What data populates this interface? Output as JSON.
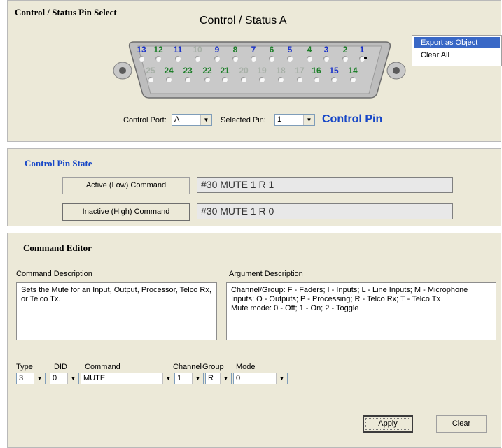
{
  "pin_select": {
    "header": "Control / Status Pin Select",
    "connector_title": "Control / Status A",
    "top_pins": [
      {
        "n": "13",
        "c": "b"
      },
      {
        "n": "12",
        "c": "g"
      },
      {
        "n": "11",
        "c": "b"
      },
      {
        "n": "10",
        "c": "l"
      },
      {
        "n": "9",
        "c": "b"
      },
      {
        "n": "8",
        "c": "g"
      },
      {
        "n": "7",
        "c": "b"
      },
      {
        "n": "6",
        "c": "g"
      },
      {
        "n": "5",
        "c": "b"
      },
      {
        "n": "4",
        "c": "g"
      },
      {
        "n": "3",
        "c": "b"
      },
      {
        "n": "2",
        "c": "g"
      },
      {
        "n": "1",
        "c": "b"
      }
    ],
    "bottom_pins": [
      {
        "n": "25",
        "c": "l"
      },
      {
        "n": "24",
        "c": "g"
      },
      {
        "n": "23",
        "c": "g"
      },
      {
        "n": "22",
        "c": "g"
      },
      {
        "n": "21",
        "c": "g"
      },
      {
        "n": "20",
        "c": "l"
      },
      {
        "n": "19",
        "c": "l"
      },
      {
        "n": "18",
        "c": "l"
      },
      {
        "n": "17",
        "c": "l"
      },
      {
        "n": "16",
        "c": "g"
      },
      {
        "n": "15",
        "c": "b"
      },
      {
        "n": "14",
        "c": "g"
      }
    ],
    "control_port_label": "Control Port:",
    "control_port_value": "A",
    "selected_pin_label": "Selected Pin:",
    "selected_pin_value": "1",
    "pin_type": "Control Pin"
  },
  "context_menu": {
    "items": [
      "Export as Object",
      "Clear All"
    ]
  },
  "pin_state": {
    "header": "Control Pin State",
    "active_label": "Active (Low) Command",
    "active_value": "#30 MUTE 1 R 1",
    "inactive_label": "Inactive (High) Command",
    "inactive_value": "#30 MUTE 1 R 0"
  },
  "editor": {
    "header": "Command Editor",
    "cmd_desc_label": "Command Description",
    "cmd_desc": "Sets the Mute for an Input, Output, Processor, Telco Rx, or Telco Tx.",
    "arg_desc_label": "Argument Description",
    "arg_desc_line1": "Channel/Group: F - Faders; I - Inputs; L - Line Inputs; M - Microphone Inputs; O - Outputs; P - Processing; R - Telco Rx; T - Telco Tx",
    "arg_desc_line2": "Mute mode: 0 - Off; 1 - On; 2 - Toggle",
    "type_label": "Type",
    "type_value": "3",
    "did_label": "DID",
    "did_value": "0",
    "command_label": "Command",
    "command_value": "MUTE",
    "channel_label": "Channel",
    "channel_value": "1",
    "group_label": "Group",
    "group_value": "R",
    "mode_label": "Mode",
    "mode_value": "0",
    "apply_label": "Apply",
    "clear_label": "Clear"
  }
}
